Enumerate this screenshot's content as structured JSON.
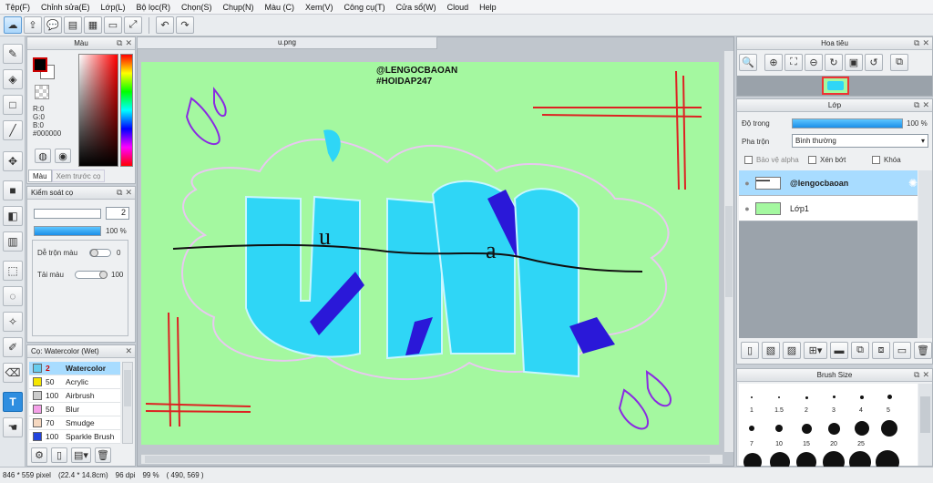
{
  "menu": [
    "Tệp(F)",
    "Chỉnh sửa(E)",
    "Lớp(L)",
    "Bộ lọc(R)",
    "Chọn(S)",
    "Chụp(N)",
    "Màu (C)",
    "Xem(V)",
    "Công cụ(T)",
    "Cửa sổ(W)",
    "Cloud",
    "Help"
  ],
  "color_panel": {
    "title": "Màu",
    "r": "R:0",
    "g": "G:0",
    "b": "B:0",
    "hex": "#000000",
    "tab_color": "Màu",
    "tab_preview": "Xem trước cọ"
  },
  "brush_control": {
    "title": "Kiểm soát cọ",
    "size_value": "2",
    "opacity_value": "100 %",
    "blend_label": "Dễ trộn màu",
    "blend_value": "0",
    "paint_label": "Tải màu",
    "paint_value": "100"
  },
  "brush_list": {
    "title": "Cọ: Watercolor (Wet)",
    "items": [
      {
        "size": "2",
        "name": "Watercolor",
        "color": "#66ccee",
        "selected": true
      },
      {
        "size": "50",
        "name": "Acrylic",
        "color": "#f5e600"
      },
      {
        "size": "100",
        "name": "Airbrush",
        "color": "#cccccc"
      },
      {
        "size": "50",
        "name": "Blur",
        "color": "#f4a0e8"
      },
      {
        "size": "70",
        "name": "Smudge",
        "color": "#f6d8c0"
      },
      {
        "size": "100",
        "name": "Sparkle Brush",
        "color": "#2244dd"
      }
    ]
  },
  "canvas": {
    "tab_title": "u.png",
    "watermark_line1": "@LENGOCBAOAN",
    "watermark_line2": "#HOIDAP247",
    "background": "#a4f8a0"
  },
  "navigator": {
    "title": "Hoa tiêu"
  },
  "layers": {
    "title": "Lớp",
    "opacity_label": "Độ trong",
    "opacity_value": "100 %",
    "blend_label": "Pha trộn",
    "blend_value": "Bình thường",
    "protect_alpha": "Bảo vệ alpha",
    "clip": "Xén bớt",
    "lock": "Khóa",
    "items": [
      {
        "name": "@lengocbaoan",
        "selected": true
      },
      {
        "name": "Lớp1",
        "selected": false
      }
    ]
  },
  "brush_size": {
    "title": "Brush Size",
    "row1": [
      "1",
      "1.5",
      "2",
      "3",
      "4",
      "5"
    ],
    "row2": [
      "7",
      "10",
      "15",
      "20",
      "25"
    ]
  },
  "status": {
    "size": "846 * 559 pixel",
    "cm": "(22.4 * 14.8cm)",
    "dpi": "96 dpi",
    "zoom": "99 %",
    "coords": "( 490, 569 )"
  }
}
